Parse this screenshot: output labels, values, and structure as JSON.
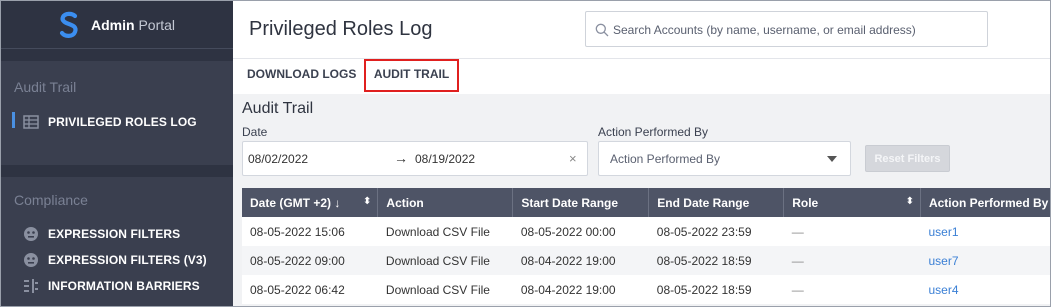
{
  "brand": {
    "bold": "Admin",
    "thin": "Portal"
  },
  "sidebar": {
    "audit_title": "Audit Trail",
    "audit_items": [
      {
        "label": "PRIVILEGED ROLES LOG",
        "icon": "table-icon"
      }
    ],
    "compliance_title": "Compliance",
    "compliance_items": [
      {
        "label": "EXPRESSION FILTERS",
        "icon": "filter-icon"
      },
      {
        "label": "EXPRESSION FILTERS (V3)",
        "icon": "filter-icon"
      },
      {
        "label": "INFORMATION BARRIERS",
        "icon": "barrier-icon"
      }
    ]
  },
  "header": {
    "title": "Privileged Roles Log",
    "search_placeholder": "Search Accounts (by name, username, or email address)"
  },
  "tabs": {
    "download": "DOWNLOAD LOGS",
    "audit": "AUDIT TRAIL"
  },
  "main": {
    "title": "Audit Trail",
    "date_label": "Date",
    "date_start": "08/02/2022",
    "date_arrow": "→",
    "date_end": "08/19/2022",
    "clear": "×",
    "action_label": "Action Performed By",
    "action_placeholder": "Action Performed By",
    "reset": "Reset Filters"
  },
  "table": {
    "columns": [
      "Date (GMT +2) ↓",
      "Action",
      "Start Date Range",
      "End Date Range",
      "Role",
      "Action Performed By"
    ],
    "sort_glyph": "⬍",
    "rows": [
      [
        "08-05-2022 15:06",
        "Download CSV File",
        "08-05-2022 00:00",
        "08-05-2022 23:59",
        "—",
        "user1"
      ],
      [
        "08-05-2022 09:00",
        "Download CSV File",
        "08-04-2022 19:00",
        "08-05-2022 18:59",
        "—",
        "user7"
      ],
      [
        "08-05-2022 06:42",
        "Download CSV File",
        "08-04-2022 19:00",
        "08-05-2022 18:59",
        "—",
        "user4"
      ]
    ]
  },
  "colors": {
    "sidebar": "#3a3f4f",
    "accent": "#4a90e2",
    "highlight": "#e0201f",
    "table_header": "#4e5466",
    "link": "#3a7fd5"
  }
}
